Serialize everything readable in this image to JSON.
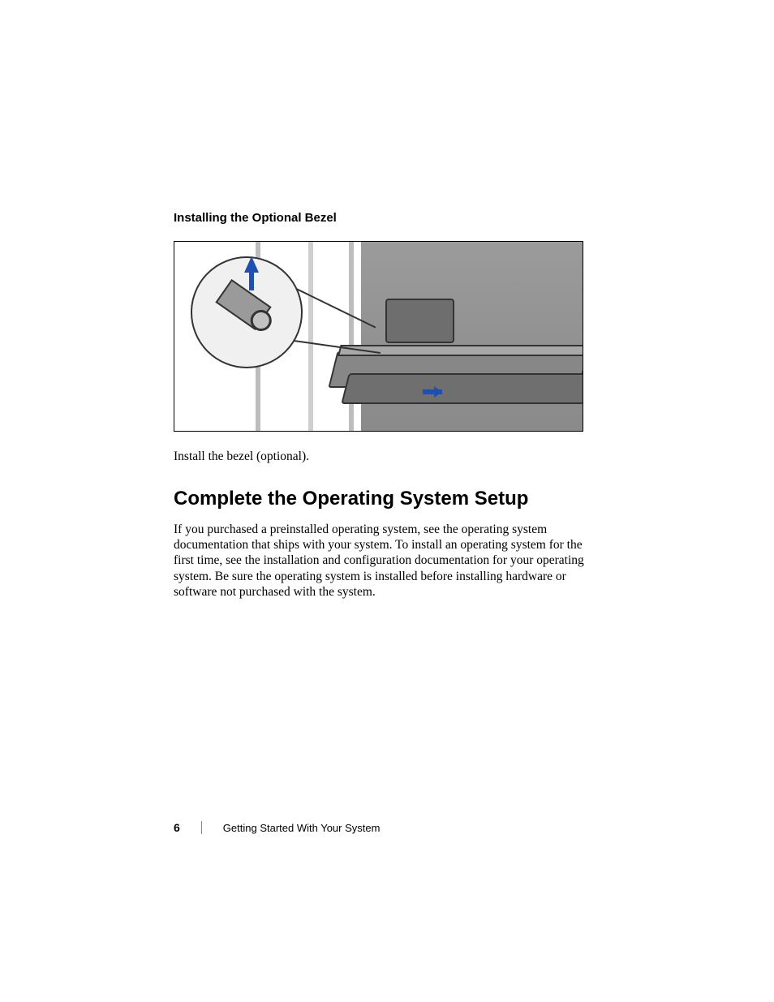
{
  "page": {
    "number": "6",
    "running_title": "Getting Started With Your System"
  },
  "subsection": {
    "title": "Installing the Optional Bezel"
  },
  "figure": {
    "alt": "Illustration of installing the optional front bezel on a rack-mounted server, with a circular callout showing the bezel key lock and arrows indicating insertion direction.",
    "elements": {
      "callout": "bezel-lock-key",
      "arrow_color": "#1e4fb3"
    }
  },
  "body_line": "Install the bezel (optional).",
  "section": {
    "title": "Complete the Operating System Setup",
    "paragraph": "If you purchased a preinstalled operating system, see the operating system documentation that ships with your system. To install an operating system for the first time, see the installation and configuration documentation for your operating system. Be sure the operating system is installed before installing hardware or software not purchased with the system."
  }
}
